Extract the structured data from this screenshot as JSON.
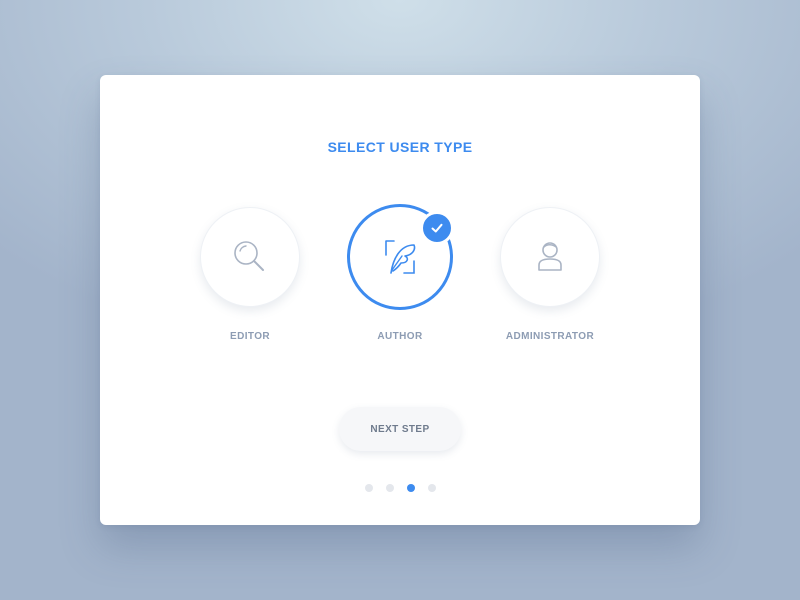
{
  "dialog": {
    "title": "SELECT USER TYPE",
    "options": [
      {
        "label": "EDITOR",
        "icon": "magnifier-icon",
        "selected": false
      },
      {
        "label": "AUTHOR",
        "icon": "quill-icon",
        "selected": true
      },
      {
        "label": "ADMINISTRATOR",
        "icon": "user-icon",
        "selected": false
      }
    ],
    "next_label": "NEXT STEP",
    "pagination": {
      "total": 4,
      "current": 3
    }
  },
  "colors": {
    "accent": "#3d8bef",
    "label": "#8d9cb3",
    "icon_inactive": "#aab4c4"
  }
}
